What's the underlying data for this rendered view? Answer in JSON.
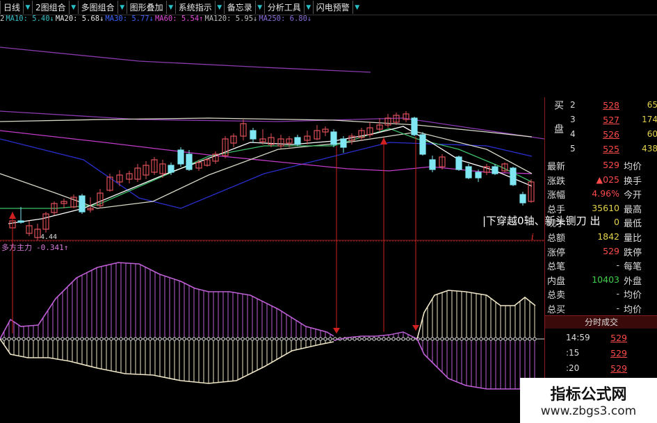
{
  "toolbar": {
    "items": [
      "日线",
      "2图组合",
      "多图组合",
      "图形叠加",
      "系统指示",
      "备忘录",
      "分析工具",
      "闪电预警"
    ]
  },
  "ma_line": {
    "items": [
      {
        "label": "2",
        "color": "#cfcfcf"
      },
      {
        "label": "MA10: 5.40↓",
        "color": "#36c0c8"
      },
      {
        "label": "MA20: 5.68↓",
        "color": "#e8e8e8"
      },
      {
        "label": "MA30: 5.77↓",
        "color": "#3b63ff"
      },
      {
        "label": "MA60: 5.54↑",
        "color": "#e24ad8"
      },
      {
        "label": "MA120: 5.95↓",
        "color": "#bdbdbd"
      },
      {
        "label": "MA250: 6.80↓",
        "color": "#8a6cd8"
      }
    ]
  },
  "chart": {
    "low_label": "4.44",
    "indicator_name": "多方主力",
    "indicator_value": "-0.341↑",
    "annotation": "|下穿越0轴、新头铡刀        出",
    "colors": {
      "up": "#e0505a",
      "down": "#7fe6f2",
      "ma_white": "#d8d8c8",
      "ma_green": "#3fbf6a",
      "ma_blue": "#2a2fd0",
      "ma_magenta": "#c03cc8",
      "ma_purple": "#8a3ab0",
      "bull": "#f0e8c8",
      "bear": "#c060d8",
      "signal": "#d02020"
    }
  },
  "orderbook": {
    "side_label": "买盘",
    "rows": [
      {
        "idx": "2",
        "price": "528",
        "vol": "65"
      },
      {
        "idx": "3",
        "price": "527",
        "vol": "174"
      },
      {
        "idx": "4",
        "price": "526",
        "vol": "60"
      },
      {
        "idx": "5",
        "price": "525",
        "vol": "438"
      }
    ]
  },
  "quote": {
    "rows": [
      {
        "label": "最新",
        "value": "529",
        "label2": "均价",
        "color": "#ff4a4a"
      },
      {
        "label": "涨跌",
        "value": "▲025",
        "label2": "换手",
        "color": "#ff4a4a"
      },
      {
        "label": "涨幅",
        "value": "4.96%",
        "label2": "今开",
        "color": "#ff4a4a"
      },
      {
        "label": "总手",
        "value": "35610",
        "label2": "最高",
        "color": "#e3d24b"
      },
      {
        "label": "现手",
        "value": "0",
        "label2": "最低",
        "color": "#e3d24b"
      },
      {
        "label": "总额",
        "value": "1842",
        "label2": "量比",
        "color": "#e3d24b"
      },
      {
        "label": "涨停",
        "value": "529",
        "label2": "跌停",
        "color": "#ff4a4a"
      },
      {
        "label": "总笔",
        "value": "-",
        "label2": "每笔",
        "color": "#ddd"
      },
      {
        "label": "内盘",
        "value": "10403",
        "label2": "外盘",
        "color": "#3fd24a"
      },
      {
        "label": "总卖",
        "value": "-",
        "label2": "均价",
        "color": "#ddd"
      },
      {
        "label": "总买",
        "value": "-",
        "label2": "均价",
        "color": "#ddd"
      }
    ]
  },
  "ticks": {
    "title": "分时成交",
    "rows": [
      {
        "time": "14:59",
        "price": "529"
      },
      {
        "time": ":15",
        "price": "529"
      },
      {
        "time": ":20",
        "price": "529"
      },
      {
        "time": ":25",
        "price": "529"
      }
    ]
  },
  "watermark": {
    "title": "指标公式网",
    "url": "www.zbgs3.com"
  }
}
